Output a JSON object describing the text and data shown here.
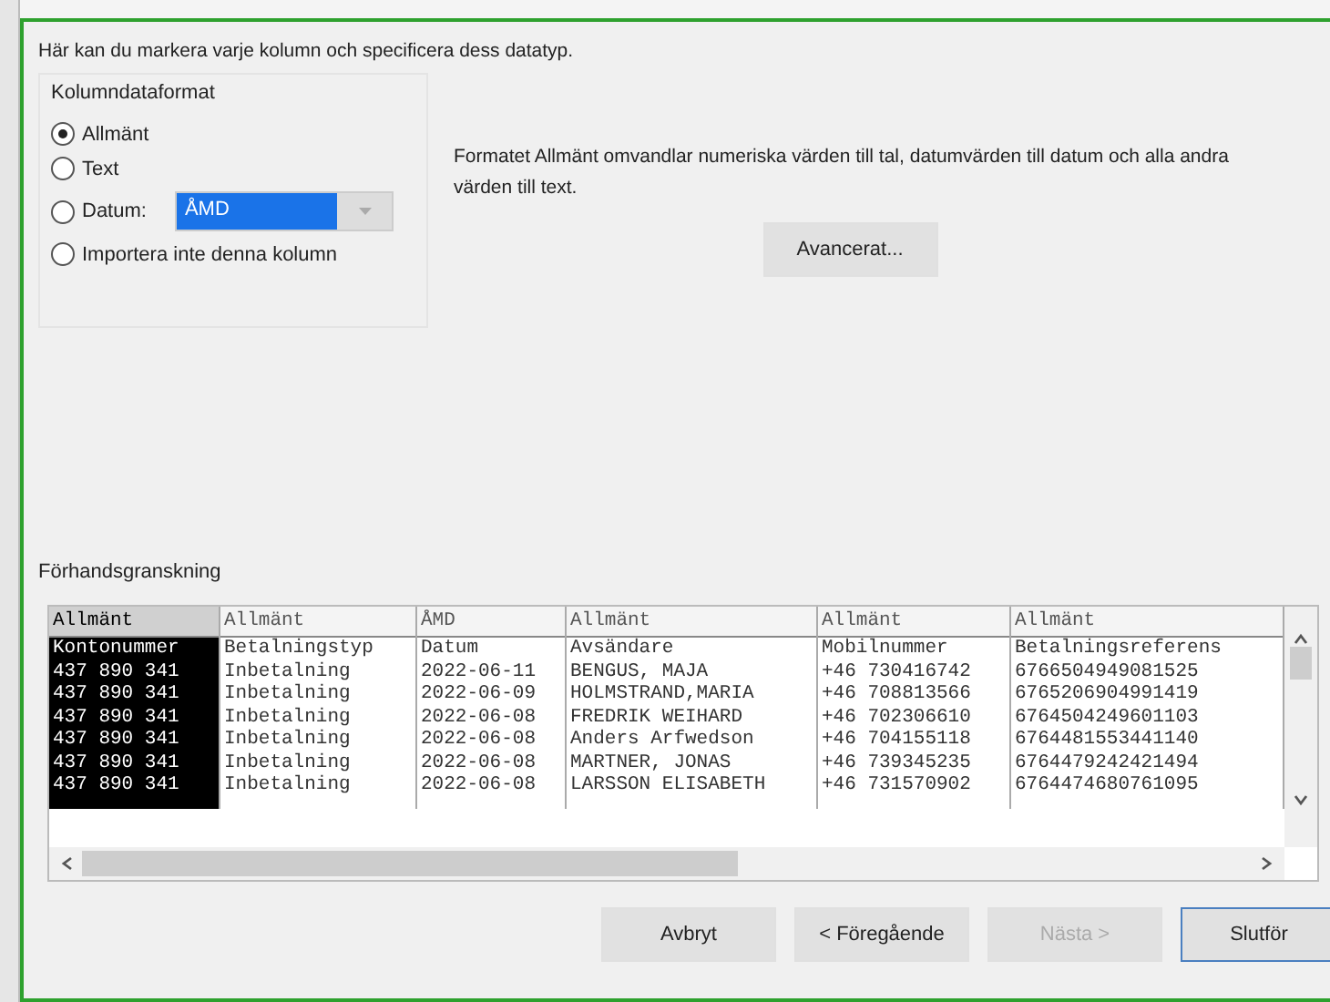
{
  "intro": "Här kan du markera varje kolumn och specificera dess datatyp.",
  "format_group": {
    "title": "Kolumndataformat",
    "options": [
      {
        "label": "Allmänt",
        "selected": true,
        "kind": "plain"
      },
      {
        "label": "Text",
        "selected": false,
        "kind": "plain"
      },
      {
        "label": "Datum:",
        "selected": false,
        "kind": "date",
        "dropdown": {
          "value": "ÅMD",
          "disabled": true
        }
      },
      {
        "label": "Importera inte denna kolumn",
        "selected": false,
        "kind": "plain"
      }
    ]
  },
  "description": "Formatet Allmänt omvandlar numeriska värden till tal, datumvärden till datum och alla andra värden till text.",
  "advanced_button": "Avancerat...",
  "preview": {
    "title": "Förhandsgranskning",
    "columns": [
      {
        "type": "Allmänt",
        "selected": true
      },
      {
        "type": "Allmänt",
        "selected": false
      },
      {
        "type": "ÅMD",
        "selected": false
      },
      {
        "type": "Allmänt",
        "selected": false
      },
      {
        "type": "Allmänt",
        "selected": false
      },
      {
        "type": "Allmänt",
        "selected": false
      }
    ],
    "rows": [
      [
        "Kontonummer",
        "Betalningstyp",
        "Datum",
        "Avsändare",
        "Mobilnummer",
        "Betalningsreferens"
      ],
      [
        "437 890 341",
        "Inbetalning",
        "2022-06-11",
        "BENGUS, MAJA",
        "+46 730416742",
        "6766504949081525"
      ],
      [
        "437 890 341",
        "Inbetalning",
        "2022-06-09",
        "HOLMSTRAND,MARIA",
        "+46 708813566",
        "6765206904991419"
      ],
      [
        "437 890 341",
        "Inbetalning",
        "2022-06-08",
        "FREDRIK WEIHARD",
        "+46 702306610",
        "6764504249601103"
      ],
      [
        "437 890 341",
        "Inbetalning",
        "2022-06-08",
        "Anders Arfwedson",
        "+46 704155118",
        "6764481553441140"
      ],
      [
        "437 890 341",
        "Inbetalning",
        "2022-06-08",
        "MARTNER, JONAS",
        "+46 739345235",
        "6764479242421494"
      ],
      [
        "437 890 341",
        "Inbetalning",
        "2022-06-08",
        "LARSSON ELISABETH",
        "+46 731570902",
        "6764474680761095"
      ]
    ]
  },
  "buttons": [
    {
      "label": "Avbryt",
      "disabled": false,
      "default": false
    },
    {
      "label": "< Föregående",
      "disabled": false,
      "default": false
    },
    {
      "label": "Nästa >",
      "disabled": true,
      "default": false
    },
    {
      "label": "Slutför",
      "disabled": false,
      "default": true
    }
  ]
}
